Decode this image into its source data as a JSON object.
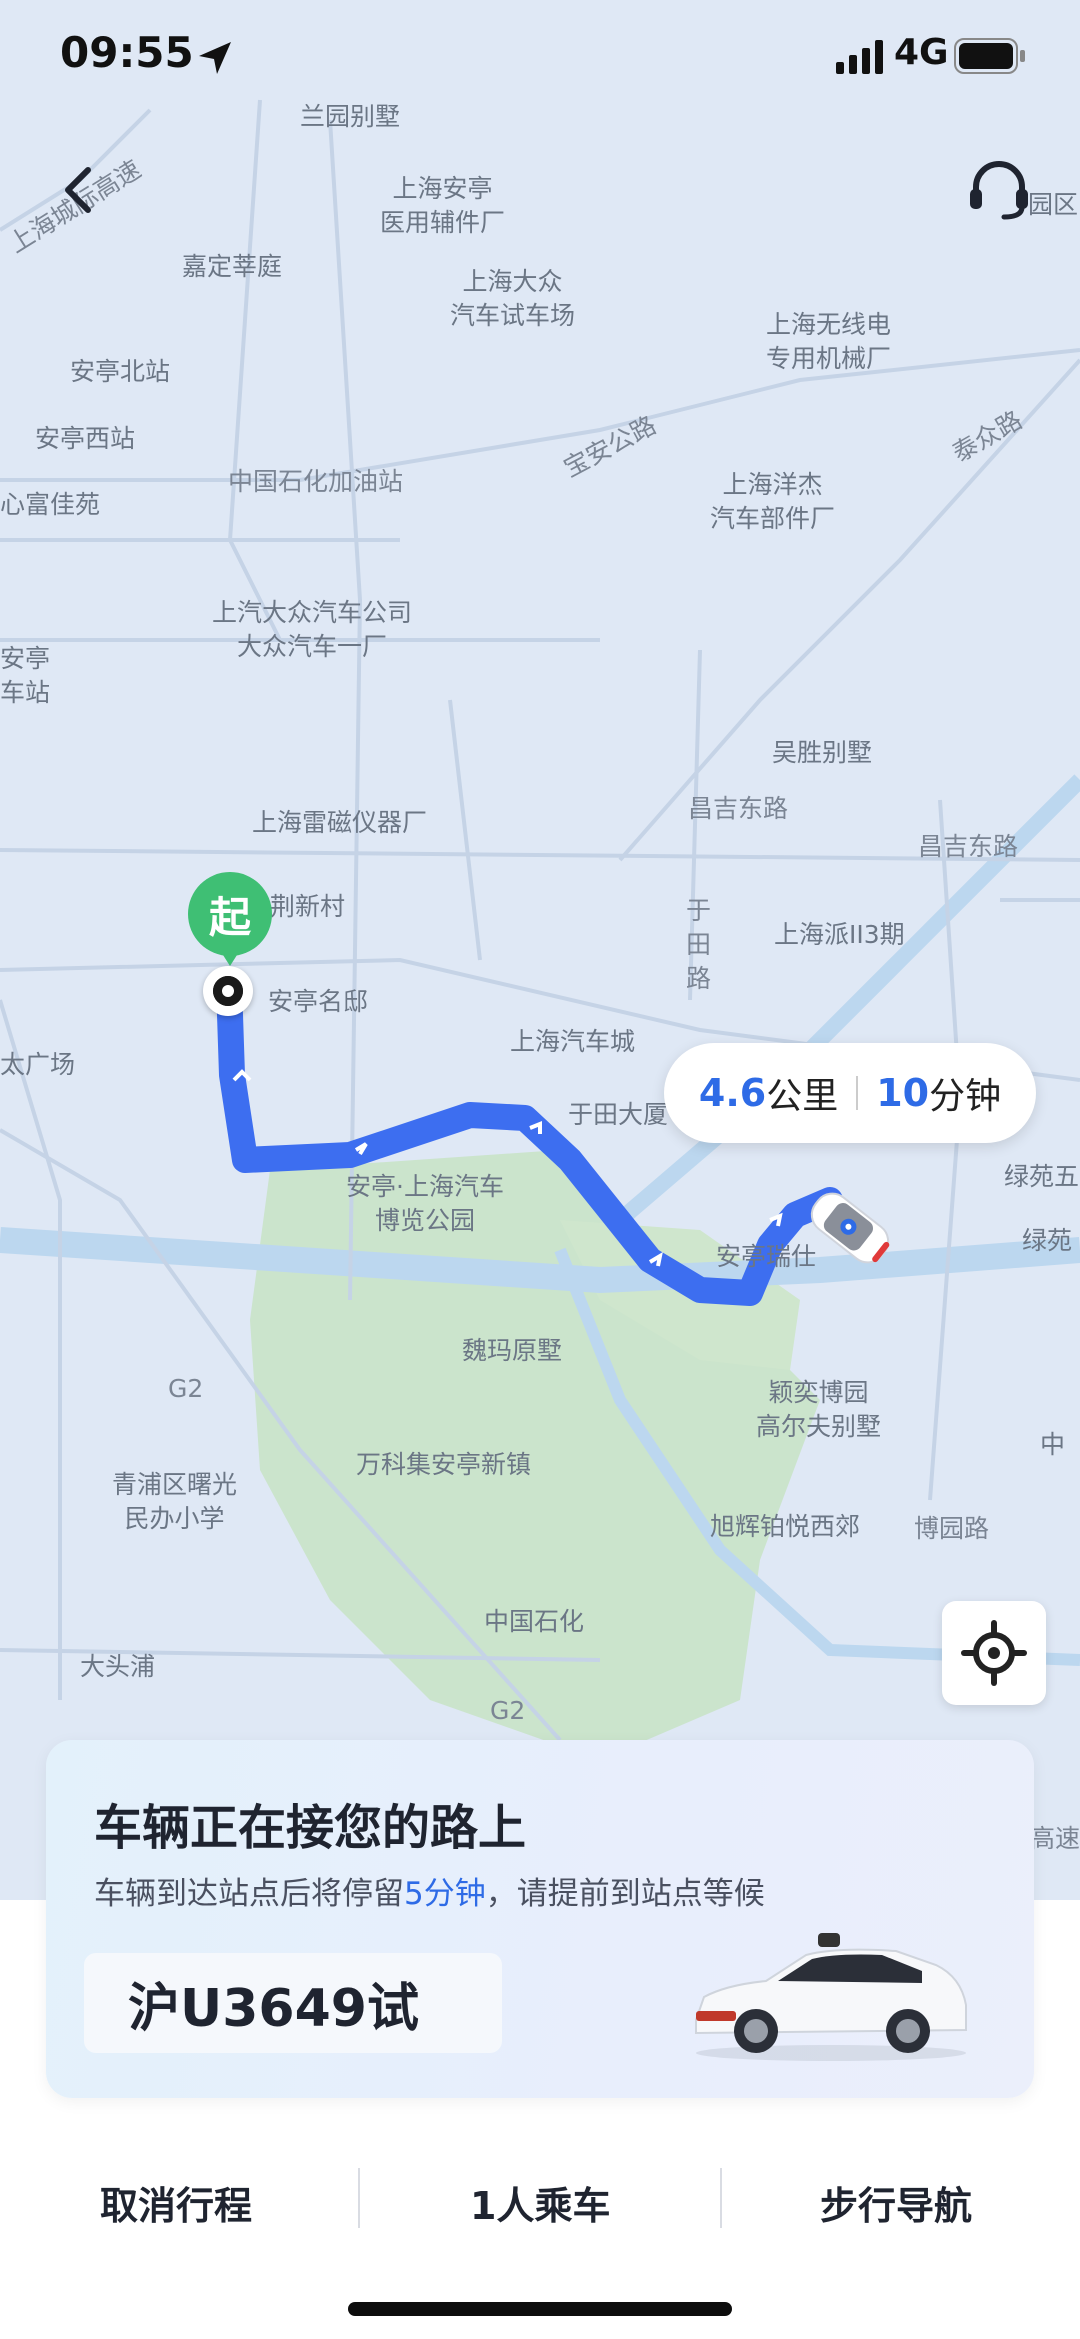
{
  "status": {
    "time": "09:55",
    "network": "4G"
  },
  "map": {
    "labels": [
      "兰园别墅",
      "上海安亭\n医用辅件厂",
      "嘉定莘庭",
      "上海大众\n汽车试车场",
      "上海无线电\n专用机械厂",
      "安亭北站",
      "安亭西站",
      "中国石化加油站",
      "宝安公路",
      "上海洋杰\n汽车部件厂",
      "泰众路",
      "心富佳苑",
      "上汽大众汽车公司\n大众汽车一厂",
      "安亭\n车站",
      "吴胜别墅",
      "昌吉东路",
      "昌吉东路",
      "上海雷磁仪器厂",
      "荆新村",
      "于\n田\n路",
      "上海派II3期",
      "安亭名邸",
      "上海汽车城",
      "于田大厦",
      "太广场",
      "安亭·上海汽车\n博览公园",
      "安亭瑞仕",
      "绿苑五",
      "绿苑",
      "魏玛原墅",
      "颖奕博园\n高尔夫别墅",
      "青浦区曙光\n民办小学",
      "万科集安亭新镇",
      "中",
      "旭辉铂悦西郊",
      "博园路",
      "中国石化",
      "大头浦",
      "G2",
      "G2",
      "上海城际高速",
      "高速",
      "园区"
    ]
  },
  "start_pin": {
    "label": "起"
  },
  "eta": {
    "distance": "4.6",
    "distance_unit": "公里",
    "time": "10",
    "time_unit": "分钟"
  },
  "card": {
    "title": "车辆正在接您的路上",
    "sub_prefix": "车辆到达站点后将停留",
    "sub_highlight": "5分钟",
    "sub_suffix": "，请提前到站点等候",
    "plate": "沪U3649试"
  },
  "bottom": {
    "cancel": "取消行程",
    "passengers": "1人乘车",
    "walk_nav": "步行导航"
  },
  "colors": {
    "route": "#3d6ef0",
    "accent": "#2e6be6",
    "pin": "#3fbf74"
  }
}
